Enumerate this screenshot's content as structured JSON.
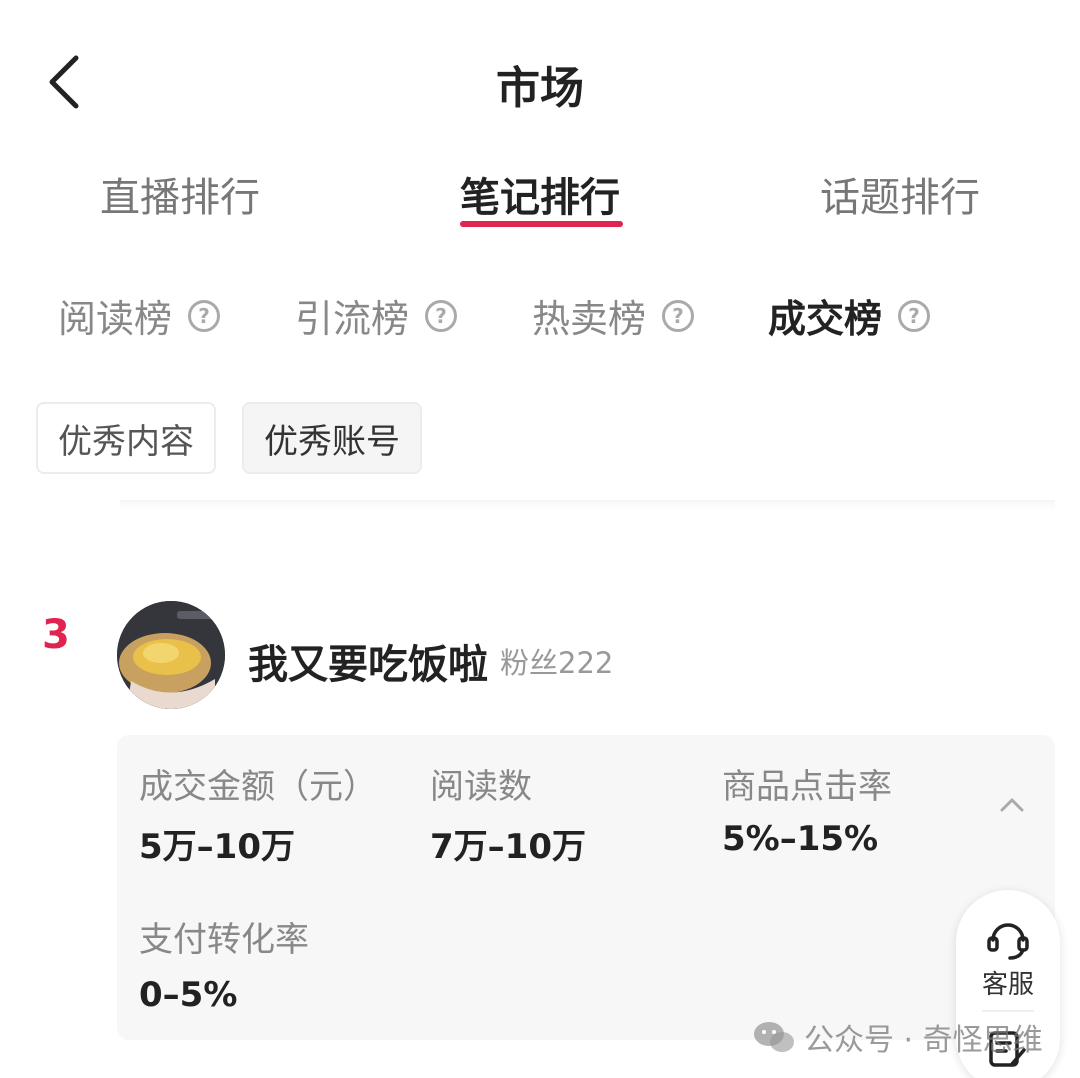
{
  "header": {
    "title": "市场"
  },
  "main_tabs": [
    {
      "label": "直播排行",
      "active": false
    },
    {
      "label": "笔记排行",
      "active": true
    },
    {
      "label": "话题排行",
      "active": false
    }
  ],
  "sub_tabs": [
    {
      "label": "阅读榜",
      "active": false
    },
    {
      "label": "引流榜",
      "active": false
    },
    {
      "label": "热卖榜",
      "active": false
    },
    {
      "label": "成交榜",
      "active": true
    }
  ],
  "help_glyph": "?",
  "filters": [
    {
      "label": "优秀内容",
      "active": false
    },
    {
      "label": "优秀账号",
      "active": true
    }
  ],
  "entry": {
    "rank": "3",
    "name": "我又要吃饭啦",
    "fans": "粉丝222",
    "stats": [
      {
        "label": "成交金额（元）",
        "value": "5万–10万"
      },
      {
        "label": "阅读数",
        "value": "7万–10万"
      },
      {
        "label": "商品点击率",
        "value": "5%–15%"
      },
      {
        "label": "支付转化率",
        "value": "0–5%"
      }
    ]
  },
  "float": {
    "service_label": "客服"
  },
  "watermark": {
    "text": "公众号 · 奇怪思维"
  },
  "colors": {
    "accent": "#e0244f",
    "card_bg": "#f7f7f7",
    "muted_text": "#888888"
  },
  "icons": [
    "back-arrow-icon",
    "help-circle-icon",
    "chevron-up-icon",
    "headset-icon",
    "note-edit-icon",
    "wechat-icon"
  ]
}
